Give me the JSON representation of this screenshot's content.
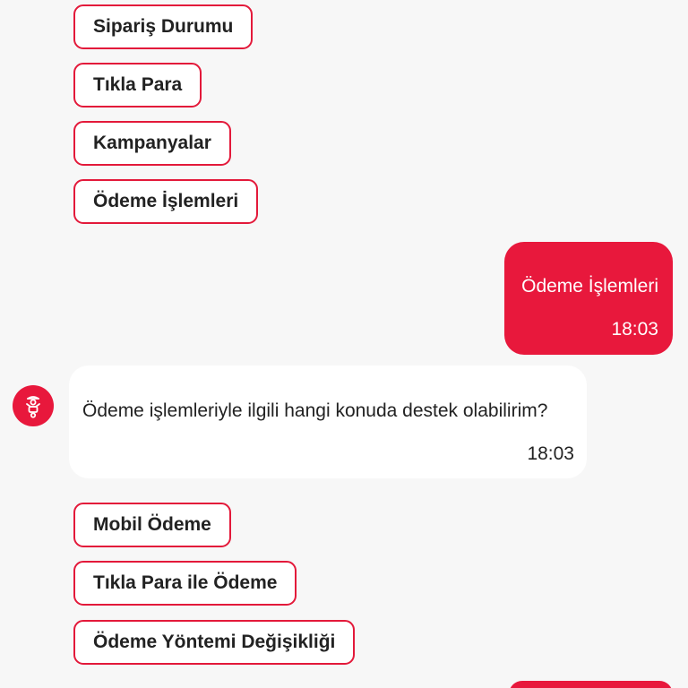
{
  "colors": {
    "accent": "#e8183c",
    "background": "#f7f7f7",
    "bot_bubble": "#ffffff",
    "text": "#222222"
  },
  "quick_replies_top": [
    {
      "label": "Sipariş Durumu"
    },
    {
      "label": "Tıkla Para"
    },
    {
      "label": "Kampanyalar"
    },
    {
      "label": "Ödeme İşlemleri"
    }
  ],
  "user_message": {
    "text": "Ödeme İşlemleri",
    "time": "18:03"
  },
  "bot_message": {
    "avatar_icon": "courier-scooter-icon",
    "text": "Ödeme işlemleriyle ilgili hangi konuda destek olabilirim?",
    "time": "18:03"
  },
  "quick_replies_bottom": [
    {
      "label": "Mobil Ödeme"
    },
    {
      "label": "Tıkla Para ile Ödeme"
    },
    {
      "label": "Ödeme Yöntemi Değişikliği"
    }
  ]
}
